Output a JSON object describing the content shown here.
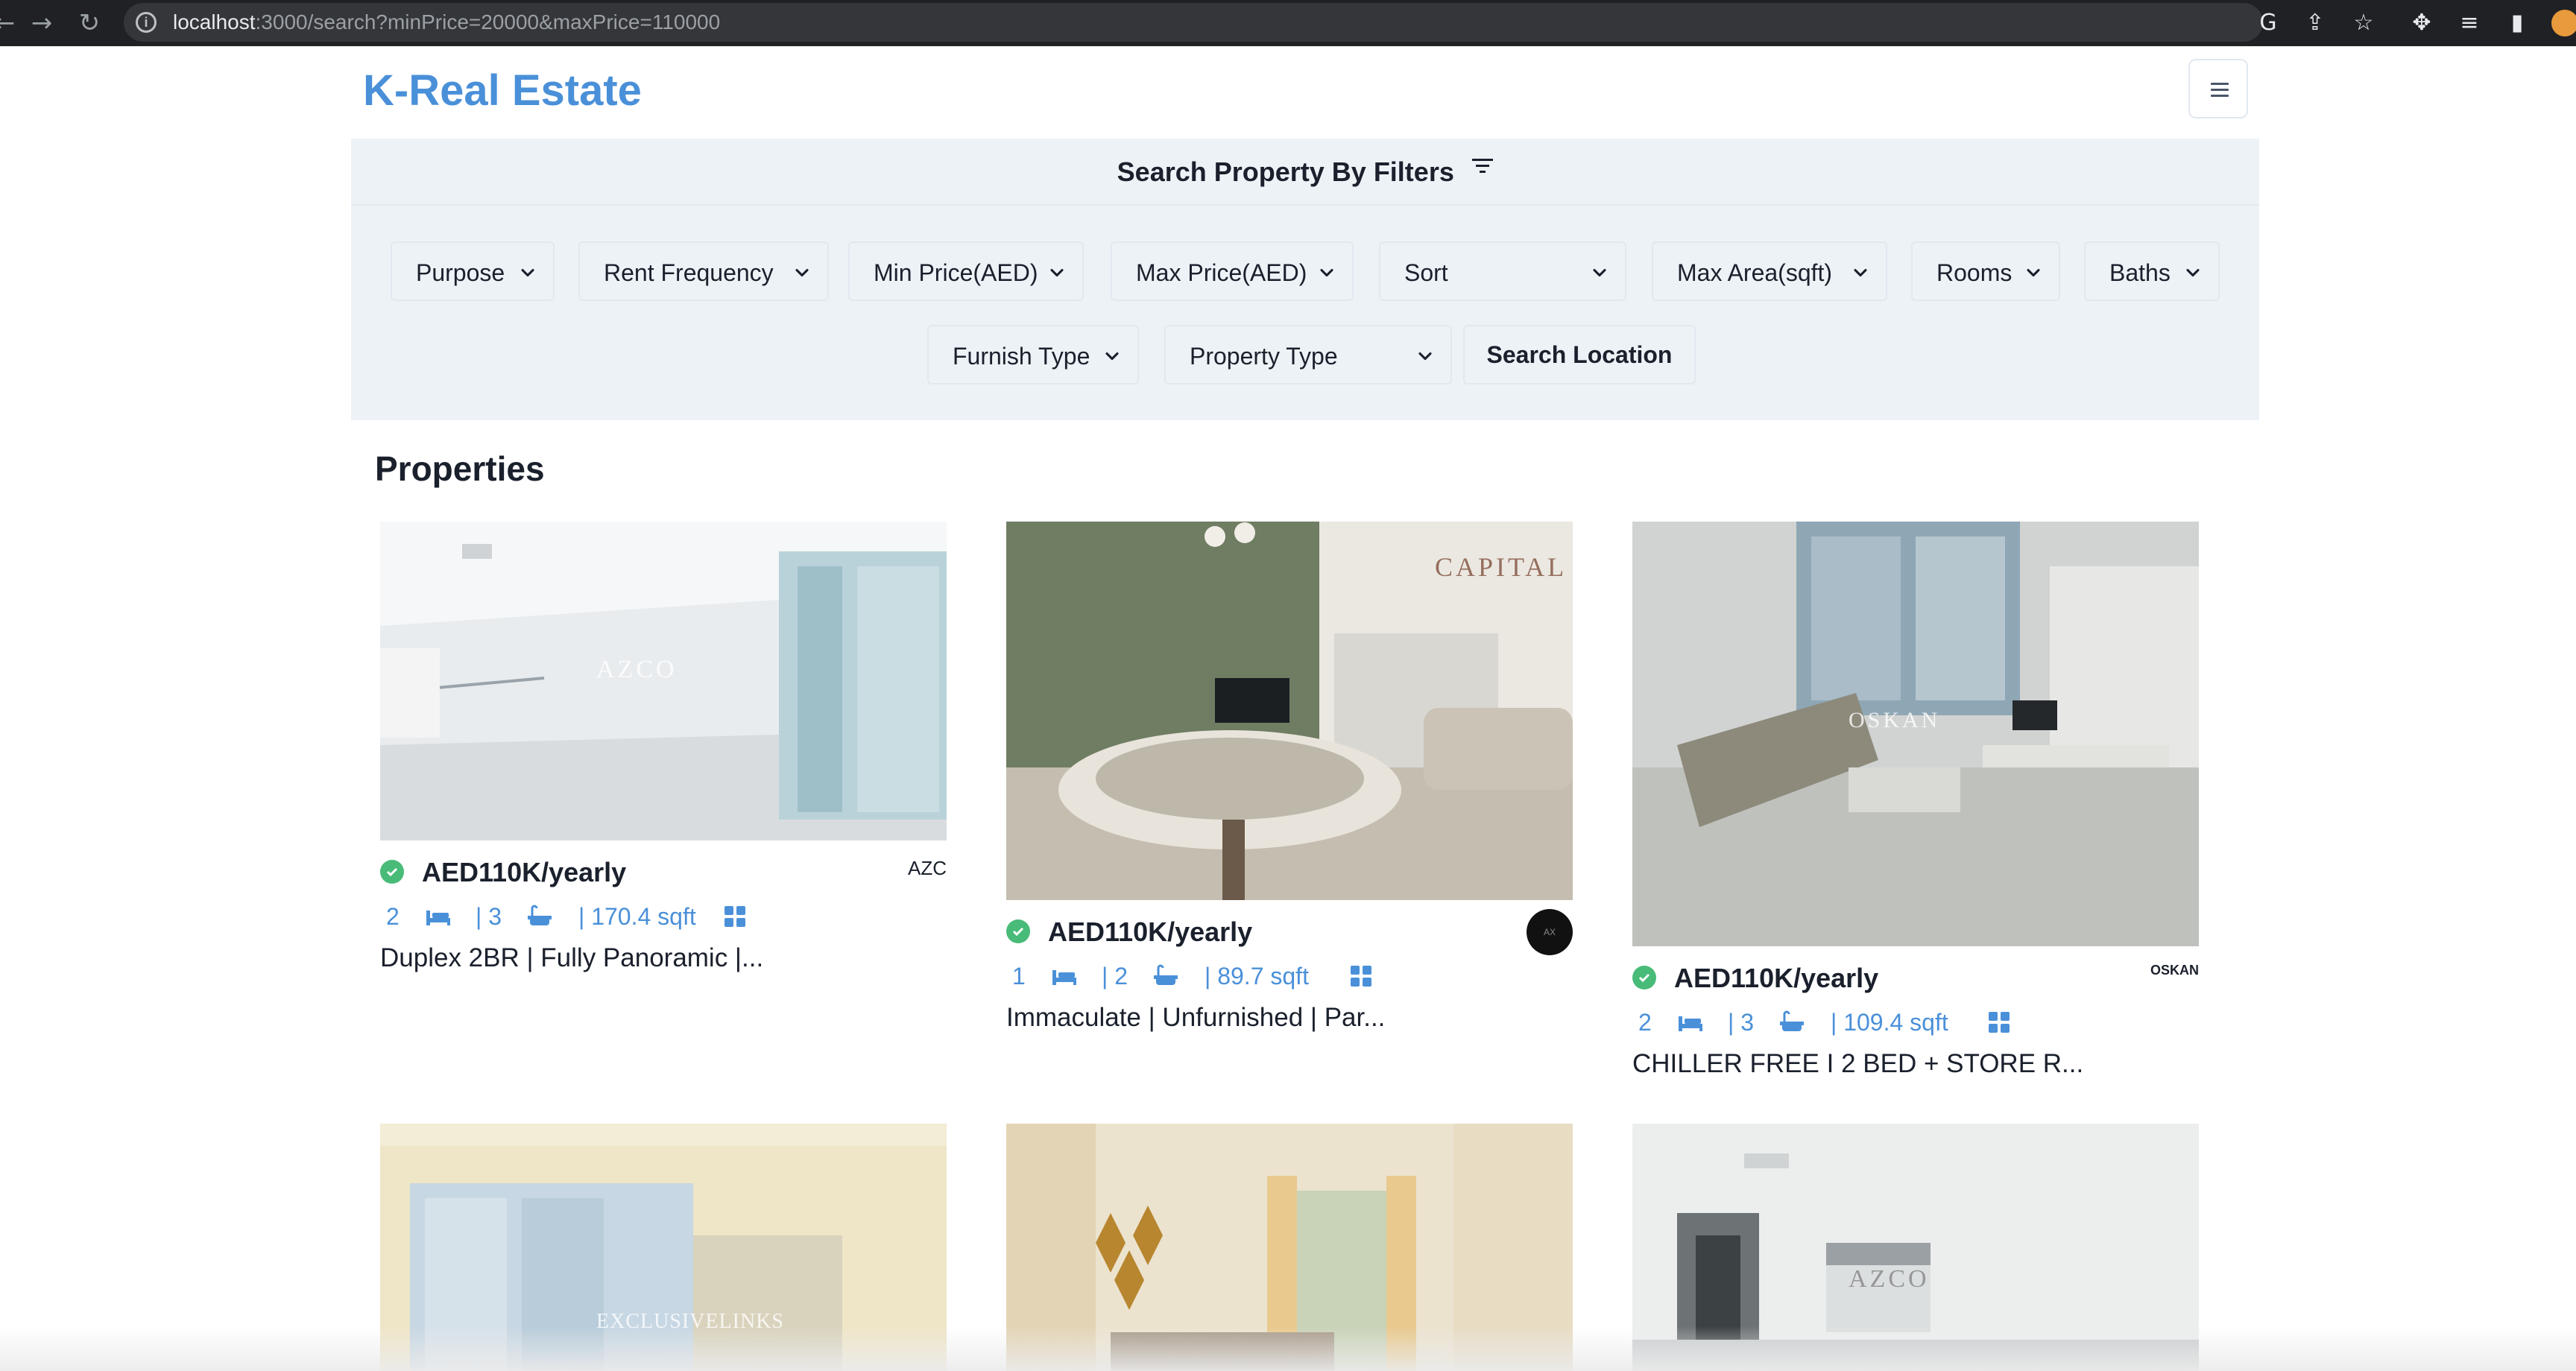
{
  "browser": {
    "url_host": "localhost",
    "url_rest": ":3000/search?minPrice=20000&maxPrice=110000"
  },
  "header": {
    "brand": "K-Real Estate",
    "brand_color": "#4a90d9"
  },
  "filters": {
    "heading": "Search Property By Filters",
    "selects": [
      "Purpose",
      "Rent Frequency",
      "Min Price(AED)",
      "Max Price(AED)",
      "Sort",
      "Max Area(sqft)",
      "Rooms",
      "Baths",
      "Furnish Type",
      "Property Type"
    ],
    "search_location": "Search Location"
  },
  "main": {
    "section_title": "Properties",
    "properties": [
      {
        "price": "AED110K/yearly",
        "rooms": "2",
        "baths": "| 3",
        "area": "| 170.4 sqft",
        "title": "Duplex 2BR | Fully Panoramic |...",
        "agency": "AZC",
        "watermark": "AZCO"
      },
      {
        "price": "AED110K/yearly",
        "rooms": "1",
        "baths": "| 2",
        "area": "| 89.7 sqft",
        "title": "Immaculate | Unfurnished | Par...",
        "agency": "AX",
        "watermark": "CAPITAL"
      },
      {
        "price": "AED110K/yearly",
        "rooms": "2",
        "baths": "| 3",
        "area": "| 109.4 sqft",
        "title": "CHILLER FREE I 2 BED + STORE R...",
        "agency": "OSKAN",
        "watermark": "OSKAN"
      },
      {
        "watermark": "EXCLUSIVELINKS"
      },
      {
        "watermark": ""
      },
      {
        "watermark": "AZCO"
      }
    ]
  }
}
